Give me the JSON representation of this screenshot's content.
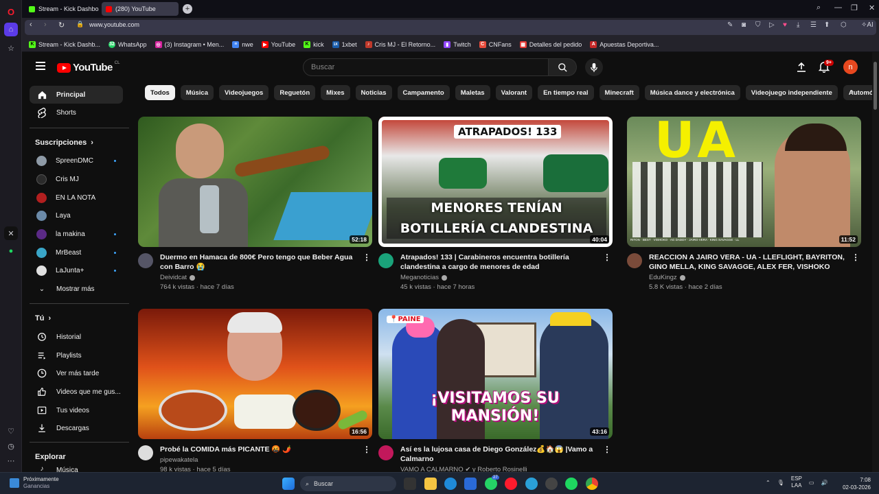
{
  "browser": {
    "tabs": [
      {
        "label": "Stream - Kick Dashboard",
        "color": "#53fc18"
      },
      {
        "label": "(280) YouTube",
        "color": "#ff0000"
      }
    ],
    "url": "www.youtube.com",
    "bookmarks": [
      {
        "label": "Stream - Kick Dashb...",
        "color": "#53fc18",
        "glyph": "K"
      },
      {
        "label": "WhatsApp",
        "color": "#25d366",
        "glyph": "32"
      },
      {
        "label": "(3) Instagram • Men...",
        "color": "#d6249f",
        "glyph": "◎"
      },
      {
        "label": "nwe",
        "color": "#4285f4",
        "glyph": "≡"
      },
      {
        "label": "YouTube",
        "color": "#ff0000",
        "glyph": "▶"
      },
      {
        "label": "kick",
        "color": "#53fc18",
        "glyph": "K"
      },
      {
        "label": "1xbet",
        "color": "#1a5dab",
        "glyph": "1X"
      },
      {
        "label": "Cris MJ - El Retorno...",
        "color": "#c0392b",
        "glyph": "♪"
      },
      {
        "label": "Twitch",
        "color": "#9146ff",
        "glyph": "▮"
      },
      {
        "label": "CNFans",
        "color": "#e74c3c",
        "glyph": "C"
      },
      {
        "label": "Detalles del pedido",
        "color": "#e53935",
        "glyph": "▦"
      },
      {
        "label": "Apuestas Deportiva...",
        "color": "#c62828",
        "glyph": "A"
      }
    ]
  },
  "masthead": {
    "logo": "YouTube",
    "country": "CL",
    "search_placeholder": "Buscar",
    "notifications": "9+",
    "avatar_letter": "n"
  },
  "guide": {
    "main": [
      {
        "label": "Principal",
        "icon": "home-icon"
      },
      {
        "label": "Shorts",
        "icon": "shorts-icon"
      }
    ],
    "subscriptions_title": "Suscripciones",
    "subscriptions": [
      {
        "label": "SpreenDMC",
        "color": "#8e9aa6",
        "dot": true
      },
      {
        "label": "Cris MJ",
        "color": "#333",
        "dot": false
      },
      {
        "label": "EN LA NOTA",
        "color": "#b21f1f",
        "dot": false
      },
      {
        "label": "Laya",
        "color": "#6b8aa8",
        "dot": false
      },
      {
        "label": "la makina",
        "color": "#5b2a86",
        "dot": true
      },
      {
        "label": "MrBeast",
        "color": "#3aa6c8",
        "dot": true
      },
      {
        "label": "LaJunta+",
        "color": "#e0e0e0",
        "dot": true
      }
    ],
    "show_more": "Mostrar más",
    "you_title": "Tú",
    "you": [
      {
        "label": "Historial",
        "icon": "history-icon"
      },
      {
        "label": "Playlists",
        "icon": "playlists-icon"
      },
      {
        "label": "Ver más tarde",
        "icon": "watch-later-icon"
      },
      {
        "label": "Videos que me gus...",
        "icon": "like-icon"
      },
      {
        "label": "Tus videos",
        "icon": "your-videos-icon"
      },
      {
        "label": "Descargas",
        "icon": "downloads-icon"
      }
    ],
    "explore_title": "Explorar",
    "explore_partial": "Música"
  },
  "chips": [
    "Todos",
    "Música",
    "Videojuegos",
    "Reguetón",
    "Mixes",
    "Noticias",
    "Campamento",
    "Maletas",
    "Valorant",
    "En tiempo real",
    "Minecraft",
    "Música dance y electrónica",
    "Videojuego independiente",
    "Automóviles"
  ],
  "videos": [
    {
      "title": "Duermo en Hamaca de 800€ Pero tengo que Beber Agua con Barro 😭",
      "channel": "Deividcat",
      "verified": true,
      "stats": "764 k vistas · hace 7 días",
      "duration": "52:18",
      "thumb_text": "",
      "avatar_color": "#556"
    },
    {
      "title": "Atrapados! 133 | Carabineros encuentra botillería clandestina a cargo de menores de edad",
      "channel": "Meganoticias",
      "verified": true,
      "stats": "45 k vistas · hace 7 horas",
      "duration": "40:04",
      "thumb_text": "MENORES TENÍAN BOTILLERÍA CLANDESTINA",
      "thumb_tag": "ATRAPADOS! 133",
      "avatar_color": "#1aa37a"
    },
    {
      "title": "REACCION A JAIRO VERA - UA - LLEFLIGHT, BAYRITON, GINO MELLA, KING SAVAGGE, ALEX FER, VISHOKO",
      "channel": "EduKingz",
      "verified": true,
      "stats": "5.8 K vistas · hace 2 días",
      "duration": "11:52",
      "thumb_text": "UA",
      "thumb_caption": "RITON · BEST · VISHOKO · AG DADDY · JAIRO VERA · KING SAVAGGE · LL",
      "avatar_color": "#7a4b3a"
    },
    {
      "title": "Probé la COMIDA más PICANTE 🤬 🌶️",
      "channel": "pipewakatela",
      "verified": false,
      "stats": "98 k vistas · hace 5 días",
      "duration": "16:56",
      "thumb_text": "",
      "avatar_color": "#ddd"
    },
    {
      "title": "Así es la lujosa casa de Diego González💰🏠😱 |Vamo a Calmarno",
      "channel": "VAMO A CALMARNO ✔ y Roberto Rosinelli",
      "verified": false,
      "stats": "",
      "duration": "43:16",
      "thumb_text": "¡VISITAMOS SU MANSIÓN!",
      "thumb_tag": "PAINE",
      "avatar_color": "#c2185b"
    }
  ],
  "taskbar": {
    "weather_line1": "Próximamente",
    "weather_line2": "Ganancias",
    "search": "Buscar",
    "lang1": "ESP",
    "lang2": "LAA",
    "time": "7:08",
    "date": "02-03-2026",
    "whatsapp_badge": "27"
  }
}
